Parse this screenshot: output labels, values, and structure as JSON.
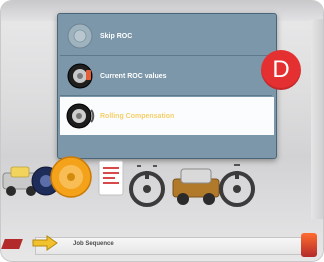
{
  "menu": {
    "items": [
      {
        "label": "Skip ROC",
        "icon": "blank-disc-icon",
        "selected": false
      },
      {
        "label": "Current ROC values",
        "icon": "tire-roc-icon",
        "selected": false
      },
      {
        "label": "Rolling Compensation",
        "icon": "rolling-tire-icon",
        "selected": true
      }
    ]
  },
  "badge": {
    "text": "D"
  },
  "bottom": {
    "label": "Job Sequence"
  },
  "icons": [
    "vehicle-lift-icon",
    "wheel-clamp-icon",
    "printout-icon",
    "steering-wheel-icon",
    "car-icon",
    "steering-wheel-alt-icon"
  ],
  "colors": {
    "popup": "#7b97a9",
    "selected_text": "#f4d06a",
    "badge": "#e53032"
  }
}
